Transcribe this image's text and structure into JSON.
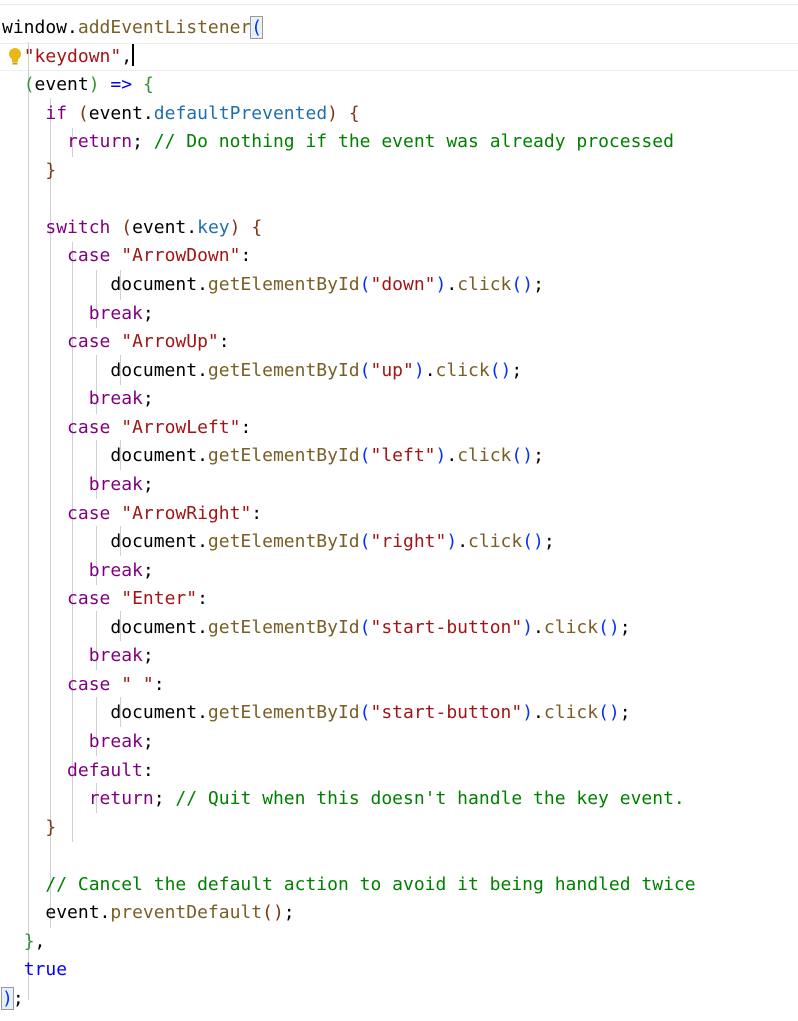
{
  "editor": {
    "lines": [
      [
        {
          "t": "window",
          "c": "pu"
        },
        {
          "t": ".",
          "c": "pu"
        },
        {
          "t": "addEventListener",
          "c": "m"
        },
        {
          "t": "(",
          "c": "b1",
          "sel": true
        }
      ],
      [
        {
          "t": "  "
        },
        {
          "t": "\"keydown\"",
          "c": "s"
        },
        {
          "t": ",",
          "c": "pu"
        },
        {
          "caret": true
        }
      ],
      [
        {
          "t": "  "
        },
        {
          "t": "(",
          "c": "b2"
        },
        {
          "t": "event",
          "c": "pu"
        },
        {
          "t": ")",
          "c": "b2"
        },
        {
          "t": " "
        },
        {
          "t": "=>",
          "c": "k"
        },
        {
          "t": " "
        },
        {
          "t": "{",
          "c": "b2"
        }
      ],
      [
        {
          "t": "    "
        },
        {
          "t": "if",
          "c": "c"
        },
        {
          "t": " "
        },
        {
          "t": "(",
          "c": "b3"
        },
        {
          "t": "event",
          "c": "pu"
        },
        {
          "t": ".",
          "c": "pu"
        },
        {
          "t": "defaultPrevented",
          "c": "p"
        },
        {
          "t": ")",
          "c": "b3"
        },
        {
          "t": " "
        },
        {
          "t": "{",
          "c": "b3"
        }
      ],
      [
        {
          "t": "      "
        },
        {
          "t": "return",
          "c": "c"
        },
        {
          "t": "; ",
          "c": "pu"
        },
        {
          "t": "// Do nothing if the event was already processed",
          "c": "cm"
        }
      ],
      [
        {
          "t": "    "
        },
        {
          "t": "}",
          "c": "b3"
        }
      ],
      [],
      [
        {
          "t": "    "
        },
        {
          "t": "switch",
          "c": "c"
        },
        {
          "t": " "
        },
        {
          "t": "(",
          "c": "b3"
        },
        {
          "t": "event",
          "c": "pu"
        },
        {
          "t": ".",
          "c": "pu"
        },
        {
          "t": "key",
          "c": "p"
        },
        {
          "t": ")",
          "c": "b3"
        },
        {
          "t": " "
        },
        {
          "t": "{",
          "c": "b3"
        }
      ],
      [
        {
          "t": "      "
        },
        {
          "t": "case",
          "c": "c"
        },
        {
          "t": " "
        },
        {
          "t": "\"ArrowDown\"",
          "c": "s"
        },
        {
          "t": ":",
          "c": "pu"
        }
      ],
      [
        {
          "t": "          "
        },
        {
          "t": "document",
          "c": "pu"
        },
        {
          "t": ".",
          "c": "pu"
        },
        {
          "t": "getElementById",
          "c": "m"
        },
        {
          "t": "(",
          "c": "b1"
        },
        {
          "t": "\"down\"",
          "c": "s"
        },
        {
          "t": ")",
          "c": "b1"
        },
        {
          "t": ".",
          "c": "pu"
        },
        {
          "t": "click",
          "c": "m"
        },
        {
          "t": "()",
          "c": "b1"
        },
        {
          "t": ";",
          "c": "pu"
        }
      ],
      [
        {
          "t": "        "
        },
        {
          "t": "break",
          "c": "c"
        },
        {
          "t": ";",
          "c": "pu"
        }
      ],
      [
        {
          "t": "      "
        },
        {
          "t": "case",
          "c": "c"
        },
        {
          "t": " "
        },
        {
          "t": "\"ArrowUp\"",
          "c": "s"
        },
        {
          "t": ":",
          "c": "pu"
        }
      ],
      [
        {
          "t": "          "
        },
        {
          "t": "document",
          "c": "pu"
        },
        {
          "t": ".",
          "c": "pu"
        },
        {
          "t": "getElementById",
          "c": "m"
        },
        {
          "t": "(",
          "c": "b1"
        },
        {
          "t": "\"up\"",
          "c": "s"
        },
        {
          "t": ")",
          "c": "b1"
        },
        {
          "t": ".",
          "c": "pu"
        },
        {
          "t": "click",
          "c": "m"
        },
        {
          "t": "()",
          "c": "b1"
        },
        {
          "t": ";",
          "c": "pu"
        }
      ],
      [
        {
          "t": "        "
        },
        {
          "t": "break",
          "c": "c"
        },
        {
          "t": ";",
          "c": "pu"
        }
      ],
      [
        {
          "t": "      "
        },
        {
          "t": "case",
          "c": "c"
        },
        {
          "t": " "
        },
        {
          "t": "\"ArrowLeft\"",
          "c": "s"
        },
        {
          "t": ":",
          "c": "pu"
        }
      ],
      [
        {
          "t": "          "
        },
        {
          "t": "document",
          "c": "pu"
        },
        {
          "t": ".",
          "c": "pu"
        },
        {
          "t": "getElementById",
          "c": "m"
        },
        {
          "t": "(",
          "c": "b1"
        },
        {
          "t": "\"left\"",
          "c": "s"
        },
        {
          "t": ")",
          "c": "b1"
        },
        {
          "t": ".",
          "c": "pu"
        },
        {
          "t": "click",
          "c": "m"
        },
        {
          "t": "()",
          "c": "b1"
        },
        {
          "t": ";",
          "c": "pu"
        }
      ],
      [
        {
          "t": "        "
        },
        {
          "t": "break",
          "c": "c"
        },
        {
          "t": ";",
          "c": "pu"
        }
      ],
      [
        {
          "t": "      "
        },
        {
          "t": "case",
          "c": "c"
        },
        {
          "t": " "
        },
        {
          "t": "\"ArrowRight\"",
          "c": "s"
        },
        {
          "t": ":",
          "c": "pu"
        }
      ],
      [
        {
          "t": "          "
        },
        {
          "t": "document",
          "c": "pu"
        },
        {
          "t": ".",
          "c": "pu"
        },
        {
          "t": "getElementById",
          "c": "m"
        },
        {
          "t": "(",
          "c": "b1"
        },
        {
          "t": "\"right\"",
          "c": "s"
        },
        {
          "t": ")",
          "c": "b1"
        },
        {
          "t": ".",
          "c": "pu"
        },
        {
          "t": "click",
          "c": "m"
        },
        {
          "t": "()",
          "c": "b1"
        },
        {
          "t": ";",
          "c": "pu"
        }
      ],
      [
        {
          "t": "        "
        },
        {
          "t": "break",
          "c": "c"
        },
        {
          "t": ";",
          "c": "pu"
        }
      ],
      [
        {
          "t": "      "
        },
        {
          "t": "case",
          "c": "c"
        },
        {
          "t": " "
        },
        {
          "t": "\"Enter\"",
          "c": "s"
        },
        {
          "t": ":",
          "c": "pu"
        }
      ],
      [
        {
          "t": "          "
        },
        {
          "t": "document",
          "c": "pu"
        },
        {
          "t": ".",
          "c": "pu"
        },
        {
          "t": "getElementById",
          "c": "m"
        },
        {
          "t": "(",
          "c": "b1"
        },
        {
          "t": "\"start-button\"",
          "c": "s"
        },
        {
          "t": ")",
          "c": "b1"
        },
        {
          "t": ".",
          "c": "pu"
        },
        {
          "t": "click",
          "c": "m"
        },
        {
          "t": "()",
          "c": "b1"
        },
        {
          "t": ";",
          "c": "pu"
        }
      ],
      [
        {
          "t": "        "
        },
        {
          "t": "break",
          "c": "c"
        },
        {
          "t": ";",
          "c": "pu"
        }
      ],
      [
        {
          "t": "      "
        },
        {
          "t": "case",
          "c": "c"
        },
        {
          "t": " "
        },
        {
          "t": "\" \"",
          "c": "s"
        },
        {
          "t": ":",
          "c": "pu"
        }
      ],
      [
        {
          "t": "          "
        },
        {
          "t": "document",
          "c": "pu"
        },
        {
          "t": ".",
          "c": "pu"
        },
        {
          "t": "getElementById",
          "c": "m"
        },
        {
          "t": "(",
          "c": "b1"
        },
        {
          "t": "\"start-button\"",
          "c": "s"
        },
        {
          "t": ")",
          "c": "b1"
        },
        {
          "t": ".",
          "c": "pu"
        },
        {
          "t": "click",
          "c": "m"
        },
        {
          "t": "()",
          "c": "b1"
        },
        {
          "t": ";",
          "c": "pu"
        }
      ],
      [
        {
          "t": "        "
        },
        {
          "t": "break",
          "c": "c"
        },
        {
          "t": ";",
          "c": "pu"
        }
      ],
      [
        {
          "t": "      "
        },
        {
          "t": "default",
          "c": "c"
        },
        {
          "t": ":",
          "c": "pu"
        }
      ],
      [
        {
          "t": "        "
        },
        {
          "t": "return",
          "c": "c"
        },
        {
          "t": "; ",
          "c": "pu"
        },
        {
          "t": "// Quit when this doesn't handle the key event.",
          "c": "cm"
        }
      ],
      [
        {
          "t": "    "
        },
        {
          "t": "}",
          "c": "b3"
        }
      ],
      [],
      [
        {
          "t": "    "
        },
        {
          "t": "// Cancel the default action to avoid it being handled twice",
          "c": "cm"
        }
      ],
      [
        {
          "t": "    "
        },
        {
          "t": "event",
          "c": "pu"
        },
        {
          "t": ".",
          "c": "pu"
        },
        {
          "t": "preventDefault",
          "c": "m"
        },
        {
          "t": "()",
          "c": "b3"
        },
        {
          "t": ";",
          "c": "pu"
        }
      ],
      [
        {
          "t": "  "
        },
        {
          "t": "}",
          "c": "b2"
        },
        {
          "t": ",",
          "c": "pu"
        }
      ],
      [
        {
          "t": "  "
        },
        {
          "t": "true",
          "c": "k"
        }
      ],
      [
        {
          "t": ")",
          "c": "b1",
          "sel": true
        },
        {
          "t": ";",
          "c": "pu"
        }
      ]
    ],
    "colors": {
      "keyword_blue": "#0000ff",
      "control_purple": "#7f007f",
      "string_red": "#a31515",
      "method_brown": "#795e26",
      "property_blue": "#1f6fb0",
      "comment_green": "#008000"
    },
    "gutter_icon": "lightbulb-icon"
  }
}
